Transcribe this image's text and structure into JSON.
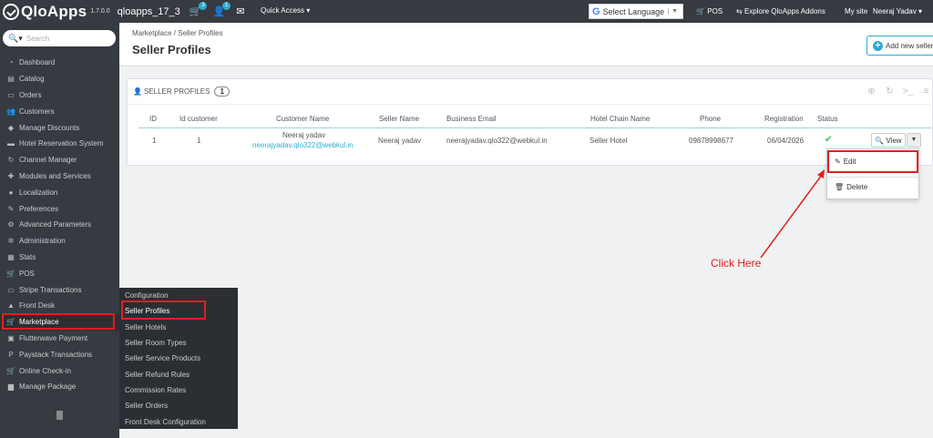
{
  "topbar": {
    "logo_text": "QloApps",
    "version": "1.7.0.0",
    "shop_name": "qloapps_17_3",
    "cart_badge": "3",
    "user_badge": "1",
    "quick_access": "Quick Access ▾",
    "language": "Select Language",
    "pos": "POS",
    "explore": "Explore QloApps Addons",
    "my_site": "My site",
    "user": "Neeraj Yadav ▾"
  },
  "sidebar": {
    "search_placeholder": "Search",
    "items": [
      {
        "label": "Dashboard",
        "icon": "dashboard-icon",
        "glyph": "◔"
      },
      {
        "label": "Catalog",
        "icon": "book-icon",
        "glyph": "▤"
      },
      {
        "label": "Orders",
        "icon": "credit-card-icon",
        "glyph": "▭"
      },
      {
        "label": "Customers",
        "icon": "users-icon",
        "glyph": "👥"
      },
      {
        "label": "Manage Discounts",
        "icon": "tag-icon",
        "glyph": "◆"
      },
      {
        "label": "Hotel Reservation System",
        "icon": "bed-icon",
        "glyph": "▬"
      },
      {
        "label": "Channel Manager",
        "icon": "refresh-icon",
        "glyph": "↻"
      },
      {
        "label": "Modules and Services",
        "icon": "puzzle-icon",
        "glyph": "✚"
      },
      {
        "label": "Localization",
        "icon": "globe-icon",
        "glyph": "●"
      },
      {
        "label": "Preferences",
        "icon": "wrench-icon",
        "glyph": "✎"
      },
      {
        "label": "Advanced Parameters",
        "icon": "cogs-icon",
        "glyph": "⚙"
      },
      {
        "label": "Administration",
        "icon": "cog-icon",
        "glyph": "✲"
      },
      {
        "label": "Stats",
        "icon": "bar-chart-icon",
        "glyph": "▦"
      },
      {
        "label": "POS",
        "icon": "cart-icon",
        "glyph": "🛒"
      },
      {
        "label": "Stripe Transactions",
        "icon": "stripe-icon",
        "glyph": "▭"
      },
      {
        "label": "Front Desk",
        "icon": "bell-icon",
        "glyph": "▲"
      },
      {
        "label": "Marketplace",
        "icon": "cart-icon",
        "glyph": "🛒"
      },
      {
        "label": "Flutterwave Payment",
        "icon": "money-icon",
        "glyph": "▣"
      },
      {
        "label": "Paystack Transactions",
        "icon": "paypal-icon",
        "glyph": "P"
      },
      {
        "label": "Online Check-in",
        "icon": "cart-icon",
        "glyph": "🛒"
      },
      {
        "label": "Manage Package",
        "icon": "briefcase-icon",
        "glyph": "▆"
      }
    ]
  },
  "submenu": {
    "items": [
      "Configuration",
      "Seller Profiles",
      "Seller Hotels",
      "Seller Room Types",
      "Seller Service Products",
      "Seller Refund Rules",
      "Commission Rates",
      "Seller Orders",
      "Front Desk Configuration"
    ]
  },
  "header": {
    "breadcrumb": "Marketplace  /  Seller Profiles",
    "title": "Seller Profiles",
    "add_button": "Add new seller"
  },
  "panel": {
    "title": "SELLER PROFILES",
    "count": "1",
    "columns": [
      "ID",
      "Id customer",
      "Customer Name",
      "Seller Name",
      "Business Email",
      "Hotel Chain Name",
      "Phone",
      "Registration",
      "Status"
    ],
    "row": {
      "id": "1",
      "id_customer": "1",
      "customer_name": "Neeraj yadav",
      "customer_email": "neerajyadav.qlo322@webkul.in",
      "seller_name": "Neeraj yadav",
      "business_email": "neerajyadav.qlo322@webkul.in",
      "hotel_chain": "Seller Hotel",
      "phone": "09878998677",
      "registration": "06/04/2026",
      "status": "✔",
      "view": "View"
    }
  },
  "dropdown": {
    "edit": "Edit",
    "delete": "Delete"
  },
  "annotation": "Click Here"
}
